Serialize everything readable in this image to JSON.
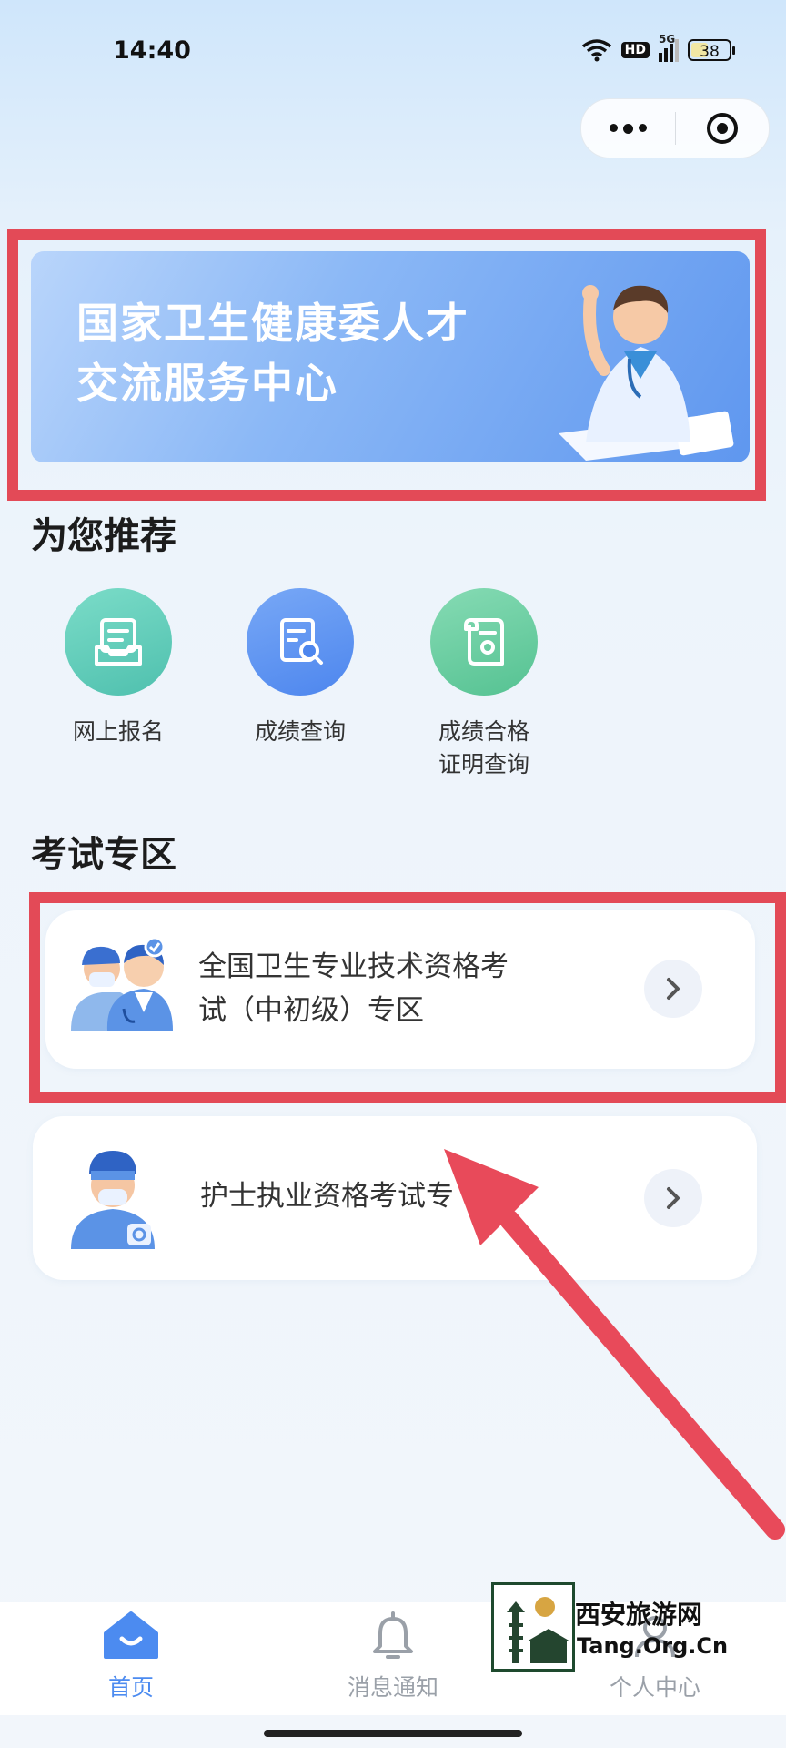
{
  "status_bar": {
    "time": "14:40",
    "hd": "HD",
    "network": "5G",
    "battery": "38"
  },
  "banner": {
    "line1": "国家卫生健康委人才",
    "line2": "交流服务中心"
  },
  "recommend": {
    "title": "为您推荐",
    "items": [
      {
        "label": "网上报名",
        "icon": "form-tray-icon",
        "color": "#5fcfba"
      },
      {
        "label": "成绩查询",
        "icon": "document-search-icon",
        "color": "#5b8ff0"
      },
      {
        "label_line1": "成绩合格",
        "label_line2": "证明查询",
        "icon": "certificate-scroll-icon",
        "color": "#6ccca2"
      }
    ]
  },
  "exam_zone": {
    "title": "考试专区",
    "cards": [
      {
        "title_line1": "全国卫生专业技术资格考",
        "title_line2": "试（中初级）专区",
        "icon": "doctors-icon"
      },
      {
        "title": "护士执业资格考试专",
        "icon": "nurse-icon"
      }
    ]
  },
  "tabbar": {
    "items": [
      {
        "label": "首页",
        "icon": "home-icon",
        "active": true
      },
      {
        "label": "消息通知",
        "icon": "bell-icon",
        "active": false
      },
      {
        "label": "个人中心",
        "icon": "person-icon",
        "active": false
      }
    ]
  },
  "watermark": {
    "title": "西安旅游网",
    "url": "Tang.Org.Cn"
  },
  "colors": {
    "highlight": "#e34a57",
    "accent": "#4c8bf0",
    "arrow": "#e84a5a"
  }
}
